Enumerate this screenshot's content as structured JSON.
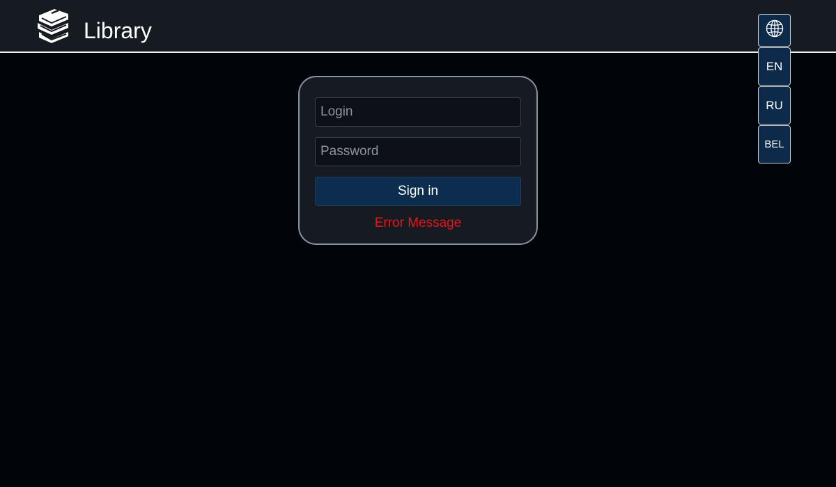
{
  "header": {
    "logo_icon": "books-stack-icon",
    "title": "Library"
  },
  "language_switcher": {
    "icon": "globe-icon",
    "options": [
      "EN",
      "RU",
      "BEL"
    ]
  },
  "login_form": {
    "login_placeholder": "Login",
    "login_value": "",
    "password_placeholder": "Password",
    "password_value": "",
    "submit_label": "Sign in",
    "error_message": "Error Message"
  },
  "colors": {
    "background": "#010409",
    "header": "#161b22",
    "card": "#161b22",
    "accent_button": "#0c2d4d",
    "error": "#e5151a"
  }
}
